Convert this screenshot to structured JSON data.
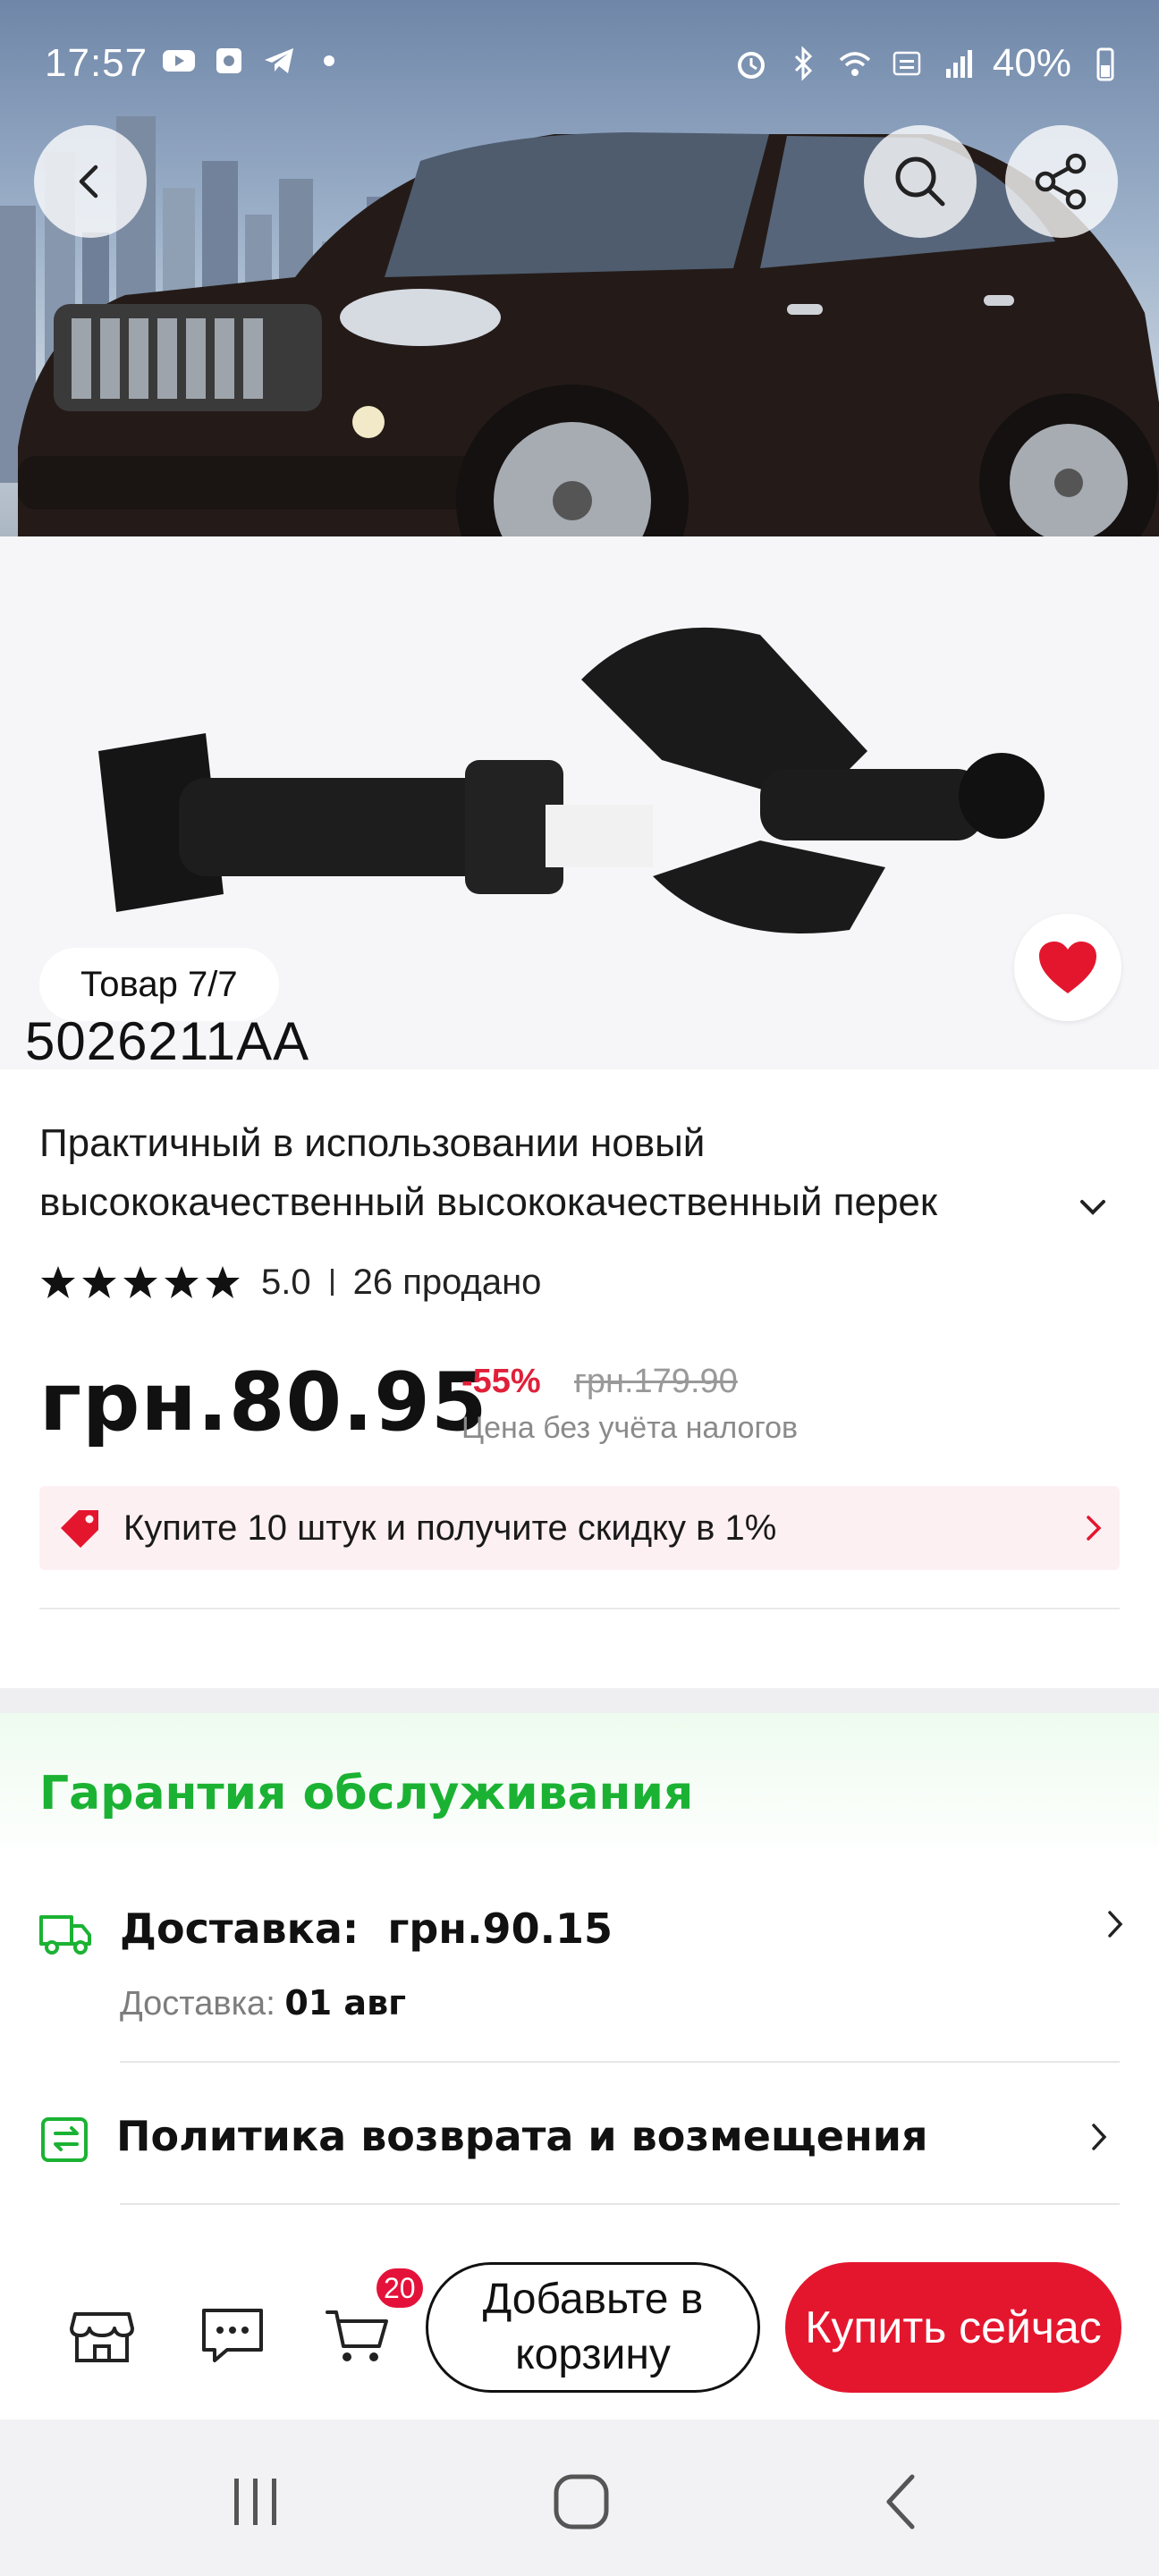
{
  "status_bar": {
    "time": "17:57",
    "battery": "40%",
    "left_icons": [
      "youtube-icon",
      "gallery-icon",
      "telegram-icon",
      "dot-icon"
    ],
    "right_icons": [
      "alarm-icon",
      "bluetooth-icon",
      "wifi-icon",
      "volte-icon",
      "signal-icon",
      "battery-icon"
    ]
  },
  "gallery": {
    "counter": "Товар 7/7",
    "part_code": "5026211AA",
    "favorited": true
  },
  "product": {
    "title_line1": "Практичный в использовании новый",
    "title_line2": "высококачественный высококачественный перек",
    "rating": "5.0",
    "stars": 5,
    "sold": "26 продано",
    "price": "грн.80.95",
    "discount": "-55%",
    "old_price": "грн.179.90",
    "tax_note": "Цена без учёта налогов",
    "promo": "Купите 10 штук и получите скидку в 1%"
  },
  "guarantee": {
    "title": "Гарантия обслуживания",
    "delivery_label": "Доставка:",
    "delivery_price": "грн.90.15",
    "delivery_date_label": "Доставка:",
    "delivery_date": "01 авг",
    "return_policy": "Политика возврата и возмещения"
  },
  "action_bar": {
    "cart_count": "20",
    "add_to_cart": "Добавьте в корзину",
    "buy_now": "Купить сейчас"
  },
  "colors": {
    "accent_red": "#e4162e",
    "discount_red": "#e0203a",
    "guarantee_green": "#1bb233",
    "promo_bg": "#fdf0f3"
  }
}
